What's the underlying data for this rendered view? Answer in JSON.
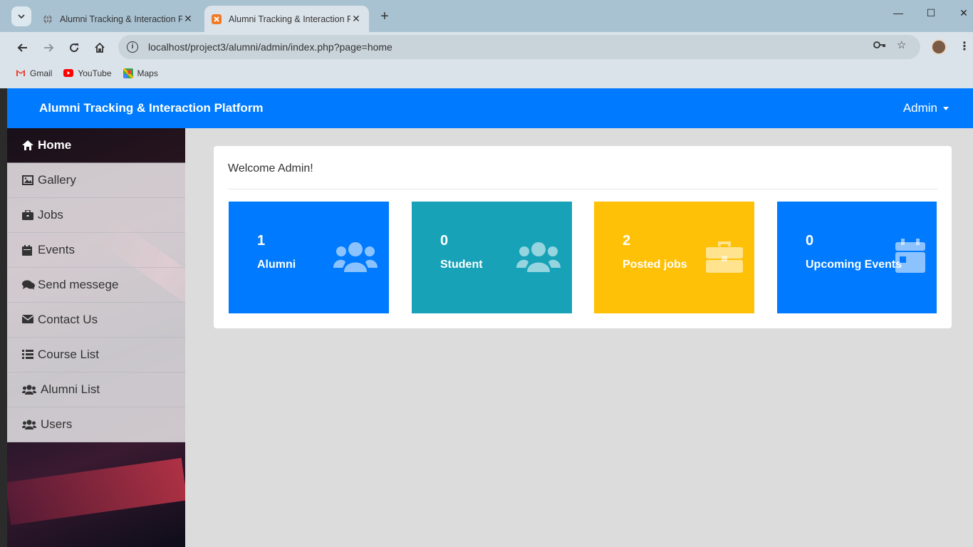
{
  "browser": {
    "tabs": [
      {
        "title": "Alumni Tracking & Interaction P",
        "active": false
      },
      {
        "title": "Alumni Tracking & Interaction P",
        "active": true
      }
    ],
    "url": "localhost/project3/alumni/admin/index.php?page=home",
    "bookmarks": [
      {
        "label": "Gmail",
        "icon": "gmail-icon"
      },
      {
        "label": "YouTube",
        "icon": "youtube-icon"
      },
      {
        "label": "Maps",
        "icon": "maps-icon"
      }
    ]
  },
  "header": {
    "brand": "Alumni Tracking & Interaction Platform",
    "user_menu": "Admin"
  },
  "sidebar": {
    "items": [
      {
        "label": "Home",
        "icon": "home-icon",
        "active": true
      },
      {
        "label": "Gallery",
        "icon": "image-icon"
      },
      {
        "label": "Jobs",
        "icon": "briefcase-icon"
      },
      {
        "label": "Events",
        "icon": "calendar-icon"
      },
      {
        "label": "Send messege",
        "icon": "comments-icon"
      },
      {
        "label": "Contact Us",
        "icon": "envelope-icon"
      },
      {
        "label": "Course List",
        "icon": "list-icon"
      },
      {
        "label": "Alumni List",
        "icon": "users-icon"
      },
      {
        "label": "Users",
        "icon": "users-icon"
      }
    ]
  },
  "main": {
    "welcome": "Welcome Admin!",
    "stats": [
      {
        "value": "1",
        "label": "Alumni",
        "color": "#007bff",
        "icon": "users-icon"
      },
      {
        "value": "0",
        "label": "Student",
        "color": "#17a2b8",
        "icon": "users-icon"
      },
      {
        "value": "2",
        "label": "Posted jobs",
        "color": "#ffc107",
        "icon": "briefcase-icon"
      },
      {
        "value": "0",
        "label": "Upcoming Events",
        "color": "#007bff",
        "icon": "calendar-icon"
      }
    ]
  },
  "colors": {
    "primary": "#007bff",
    "info": "#17a2b8",
    "warning": "#ffc107",
    "page_bg": "#dcdcdc"
  }
}
